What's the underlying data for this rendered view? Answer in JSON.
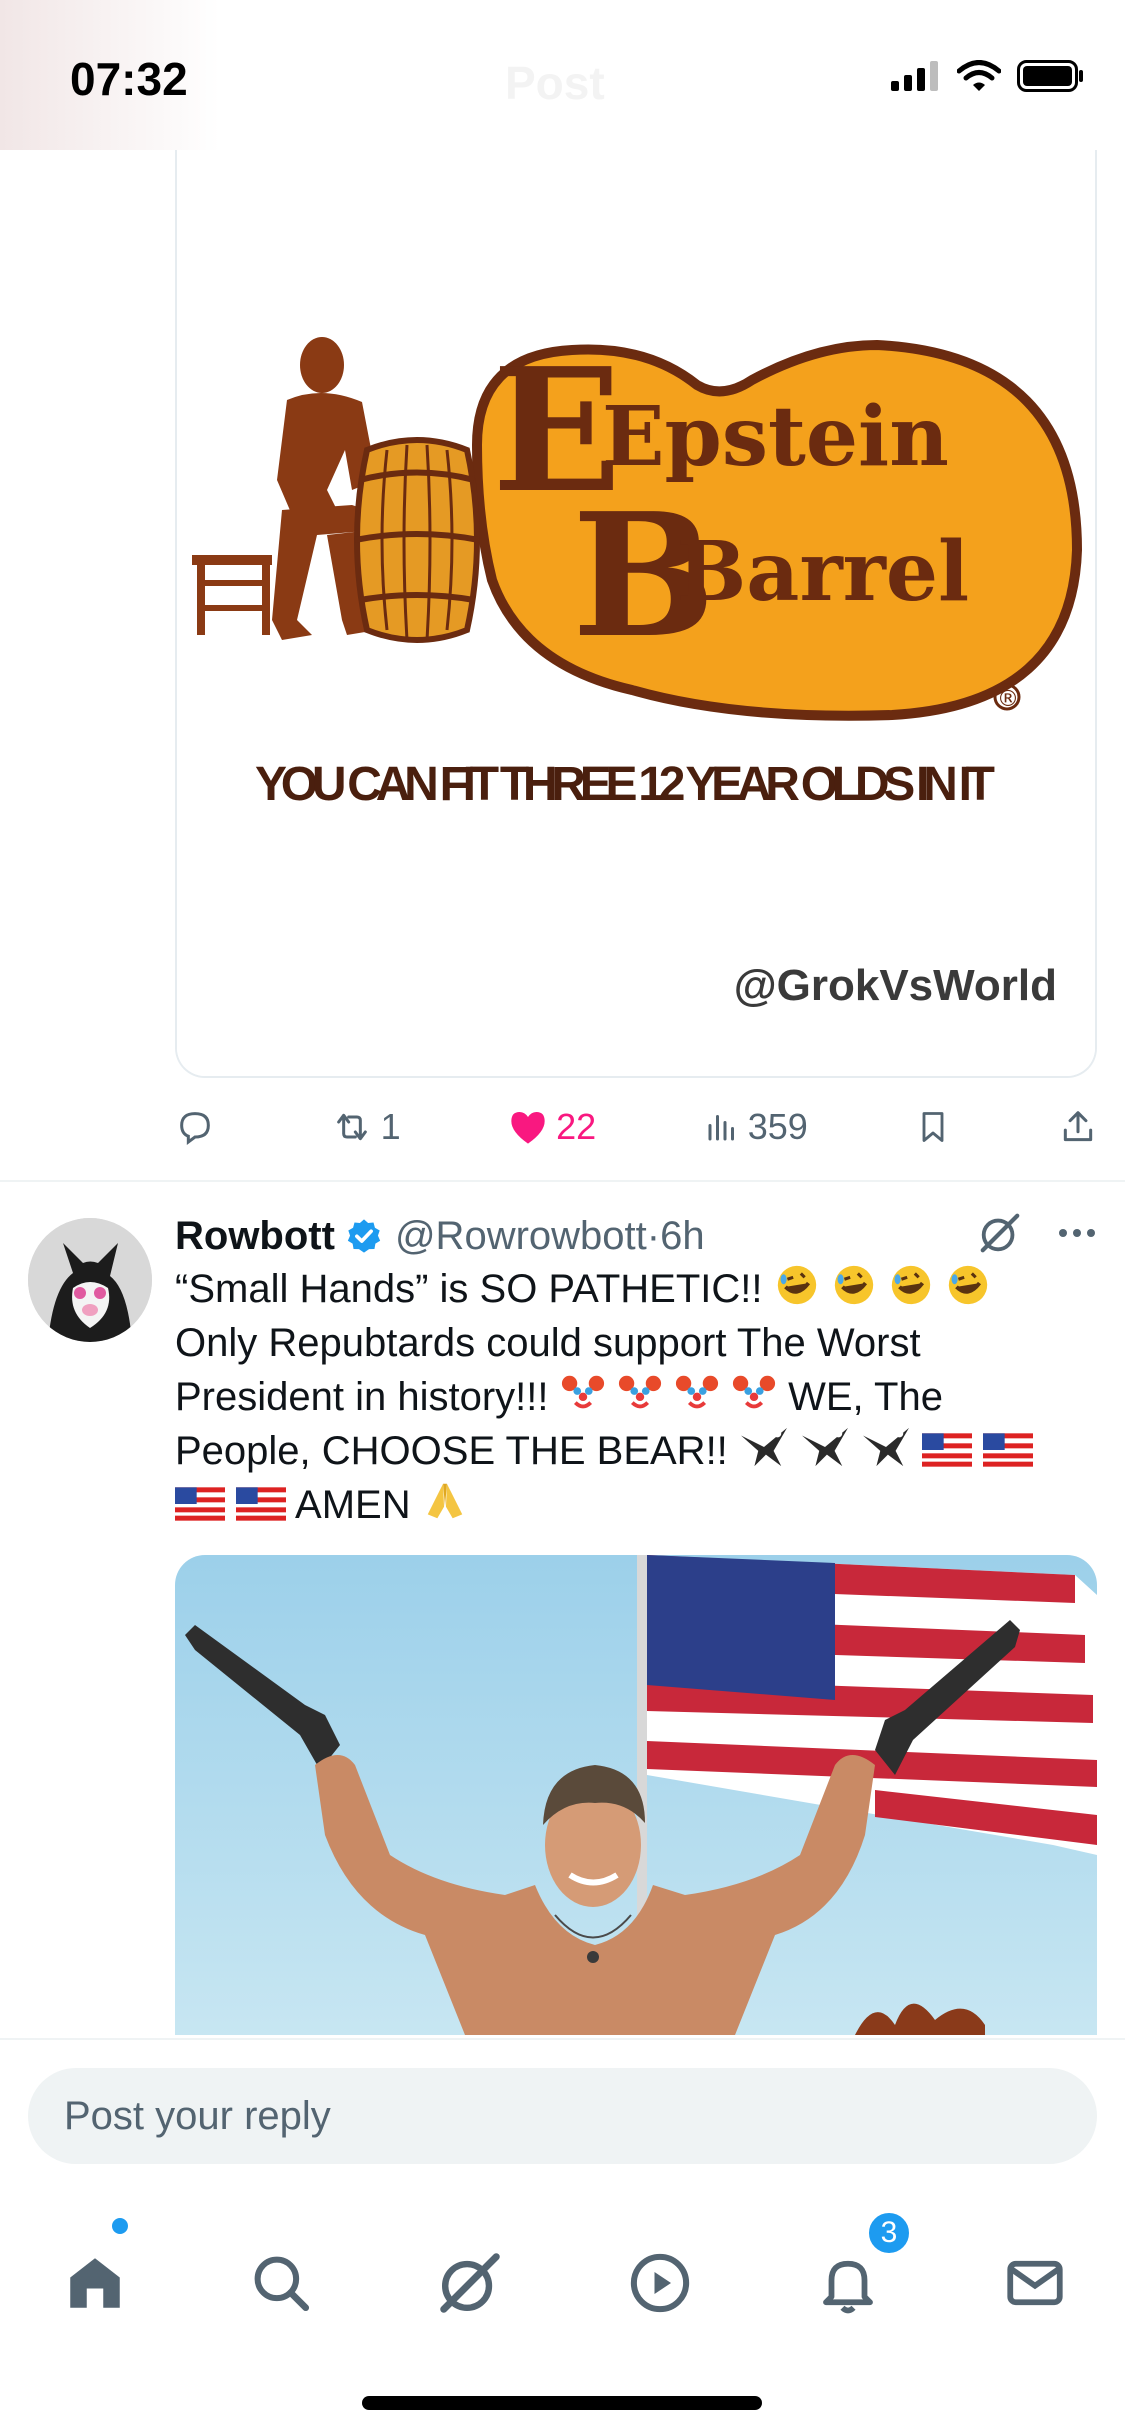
{
  "status_bar": {
    "time": "07:32",
    "ghost_title": "Post"
  },
  "quoted_image": {
    "brand_line1": "Epstein",
    "brand_line2": "Barrel",
    "tagline": "YOU CAN FIT THREE 12 YEAR OLDS IN IT",
    "watermark": "@GrokVsWorld",
    "registered": "®"
  },
  "post1_actions": {
    "replies": "",
    "reposts": "1",
    "likes": "22",
    "views": "359"
  },
  "post2": {
    "author": "Rowbott",
    "handle": "@Rowrowbott",
    "separator": "·",
    "time": "6h",
    "text_segments": {
      "s1": "“Small Hands” is SO PATHETIC!! ",
      "s2": "Only Repubtards could support The Worst President in history!!! ",
      "s3": "WE, The People, CHOOSE THE BEAR!! ",
      "s4": "AMEN "
    }
  },
  "reply": {
    "placeholder": "Post your reply"
  },
  "tabbar": {
    "notifications_badge": "3"
  },
  "colors": {
    "accent": "#1d9bf0",
    "like": "#f91880",
    "muted": "#536471",
    "logo_orange": "#f4a11c",
    "logo_brown": "#6b2b10"
  },
  "icons": [
    "signal-icon",
    "wifi-icon",
    "battery-icon",
    "reply-icon",
    "repost-icon",
    "like-icon",
    "views-icon",
    "bookmark-icon",
    "share-icon",
    "verified-icon",
    "grok-icon",
    "more-icon",
    "home-icon",
    "search-icon",
    "grok-tab-icon",
    "play-icon",
    "bell-icon",
    "mail-icon"
  ]
}
